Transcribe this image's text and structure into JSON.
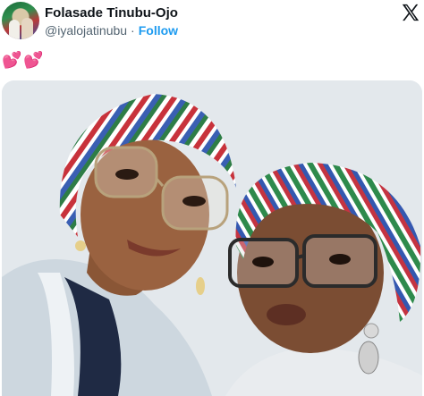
{
  "tweet": {
    "author_name": "Folasade Tinubu-Ojo",
    "handle": "@iyalojatinubu",
    "separator": "·",
    "follow_label": "Follow",
    "text": "💕💕"
  },
  "icons": {
    "platform": "x-logo-icon",
    "avatar": "profile-avatar"
  },
  "colors": {
    "name": "#0f1419",
    "handle": "#536471",
    "follow": "#1d9bf0"
  }
}
